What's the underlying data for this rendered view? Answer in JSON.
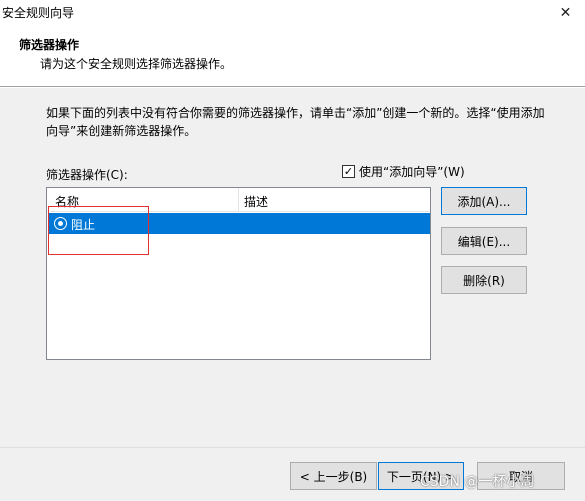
{
  "window": {
    "title": "安全规则向导",
    "close_glyph": "✕"
  },
  "header": {
    "title": "筛选器操作",
    "subtitle": "请为这个安全规则选择筛选器操作。"
  },
  "description": "如果下面的列表中没有符合你需要的筛选器操作，请单击“添加”创建一个新的。选择“使用添加向导”来创建新筛选器操作。",
  "filter_actions": {
    "label": "筛选器操作(C):",
    "use_wizard_label": "使用“添加向导”(W)",
    "use_wizard_checked": true,
    "columns": [
      "名称",
      "描述"
    ],
    "rows": [
      {
        "name": "阻止",
        "description": "",
        "selected": true
      }
    ]
  },
  "side_buttons": {
    "add": "添加(A)...",
    "edit": "编辑(E)...",
    "delete": "删除(R)"
  },
  "footer": {
    "back": "< 上一步(B)",
    "next": "下一页(N) >",
    "cancel": "取消"
  },
  "watermark": "CSDN @一杯小周",
  "icons": {
    "close": "close-icon",
    "checkbox": "checkmark-icon",
    "radio": "radio-selected-icon"
  }
}
